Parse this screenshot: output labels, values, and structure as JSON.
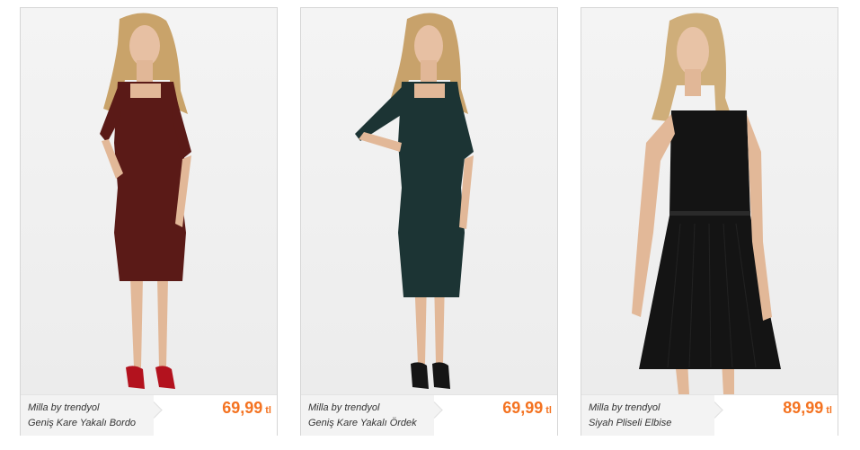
{
  "products": [
    {
      "brand": "Milla by trendyol",
      "title": "Geniş Kare Yakalı Bordo",
      "price": "69,99",
      "currency": "tl",
      "dress_color": "#5a1a17",
      "image_alt": "woman-in-burgundy-dress"
    },
    {
      "brand": "Milla by trendyol",
      "title": "Geniş Kare Yakalı Ördek",
      "price": "69,99",
      "currency": "tl",
      "dress_color": "#1c3434",
      "image_alt": "woman-in-dark-teal-dress"
    },
    {
      "brand": "Milla by trendyol",
      "title": "Siyah Pliseli Elbise",
      "price": "89,99",
      "currency": "tl",
      "dress_color": "#141414",
      "image_alt": "woman-in-black-pleated-dress"
    }
  ],
  "colors": {
    "price": "#f47321",
    "border": "#d6d6d6",
    "info_background": "#f3f3f3"
  }
}
